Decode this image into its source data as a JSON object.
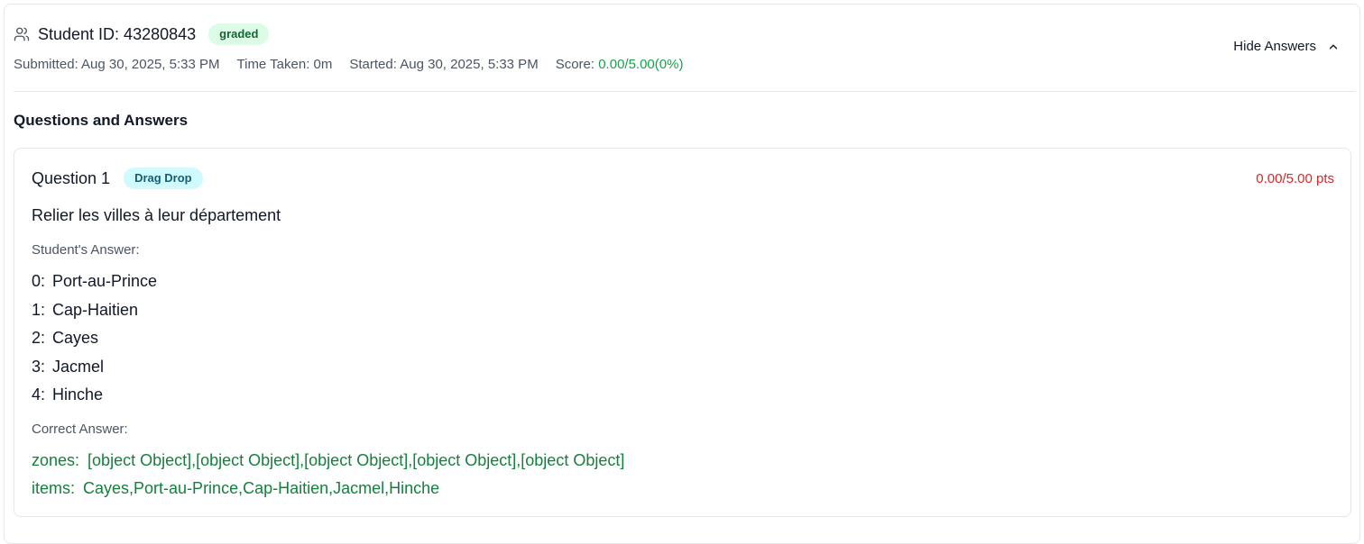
{
  "header": {
    "title": "Student ID: 43280843",
    "status_badge": "graded",
    "submitted": "Submitted: Aug 30, 2025, 5:33 PM",
    "time_taken": "Time Taken: 0m",
    "started": "Started: Aug 30, 2025, 5:33 PM",
    "score_label": "Score: ",
    "score_value": "0.00/5.00(0%)",
    "hide_answers_label": "Hide Answers"
  },
  "section_title": "Questions and Answers",
  "question": {
    "label": "Question 1",
    "type_badge": "Drag Drop",
    "points": "0.00/5.00 pts",
    "text": "Relier les villes à leur département",
    "student_answer_label": "Student's Answer:",
    "student_answers": [
      {
        "key": "0:",
        "value": "Port-au-Prince"
      },
      {
        "key": "1:",
        "value": "Cap-Haitien"
      },
      {
        "key": "2:",
        "value": "Cayes"
      },
      {
        "key": "3:",
        "value": "Jacmel"
      },
      {
        "key": "4:",
        "value": "Hinche"
      }
    ],
    "correct_answer_label": "Correct Answer:",
    "correct_answers": [
      {
        "key": "zones:",
        "value": "[object Object],[object Object],[object Object],[object Object],[object Object]"
      },
      {
        "key": "items:",
        "value": "Cayes,Port-au-Prince,Cap-Haitien,Jacmel,Hinche"
      }
    ]
  },
  "colors": {
    "graded_bg": "#dcfce7",
    "score_green": "#16a34a",
    "points_red": "#dc2626",
    "type_badge_bg": "#cffafe",
    "correct_green": "#15803d"
  },
  "icons": {
    "user": "users-icon",
    "chevron": "chevron-up-icon"
  }
}
